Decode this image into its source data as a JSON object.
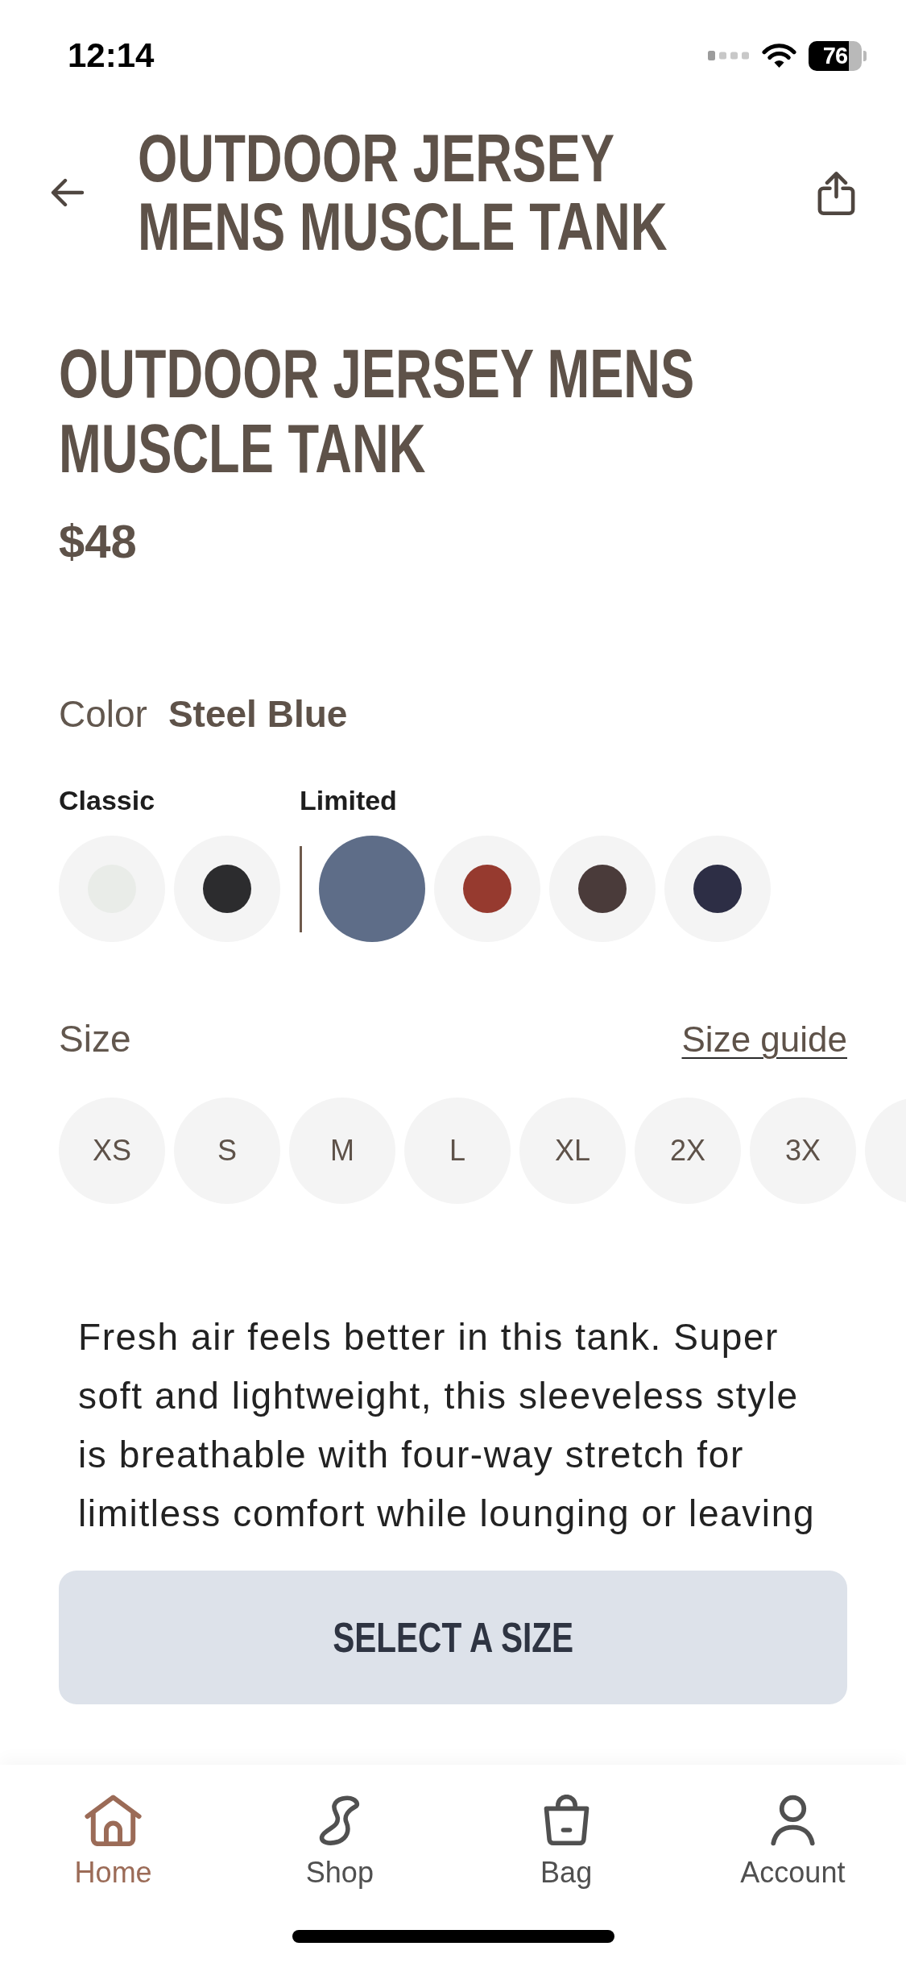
{
  "status_bar": {
    "time": "12:14",
    "battery": "76"
  },
  "header": {
    "title": "OUTDOOR JERSEY MENS MUSCLE TANK"
  },
  "product": {
    "title": "OUTDOOR JERSEY MENS MUSCLE TANK",
    "price": "$48"
  },
  "color_picker": {
    "label": "Color",
    "value": "Steel Blue",
    "groups": [
      {
        "label": "Classic",
        "swatches": [
          {
            "color": "#e9ece8",
            "selected": false
          },
          {
            "color": "#2c2c2e",
            "selected": false
          }
        ]
      },
      {
        "label": "Limited",
        "swatches": [
          {
            "color": "#5e6d88",
            "selected": true
          },
          {
            "color": "#963a2f",
            "selected": false
          },
          {
            "color": "#4a3b3a",
            "selected": false
          },
          {
            "color": "#2d2e45",
            "selected": false
          }
        ]
      }
    ]
  },
  "size_picker": {
    "label": "Size",
    "guide_link": "Size guide",
    "options": [
      {
        "label": "XS",
        "selected": false
      },
      {
        "label": "S",
        "selected": false
      },
      {
        "label": "M",
        "selected": false
      },
      {
        "label": "L",
        "selected": false
      },
      {
        "label": "XL",
        "selected": false
      },
      {
        "label": "2X",
        "selected": false
      },
      {
        "label": "3X",
        "selected": false
      }
    ],
    "more_options": true
  },
  "description": "Fresh air feels better in this tank. Super soft and lightweight, this sleeveless style is breathable with four-way stretch for limitless comfort while lounging or leaving",
  "primary_button": {
    "label": "SELECT A SIZE"
  },
  "tab_bar": [
    {
      "kind": "home",
      "label": "Home",
      "selected": true
    },
    {
      "kind": "shop",
      "label": "Shop",
      "selected": false
    },
    {
      "kind": "bag",
      "label": "Bag",
      "selected": false
    },
    {
      "kind": "account",
      "label": "Account",
      "selected": false
    }
  ]
}
